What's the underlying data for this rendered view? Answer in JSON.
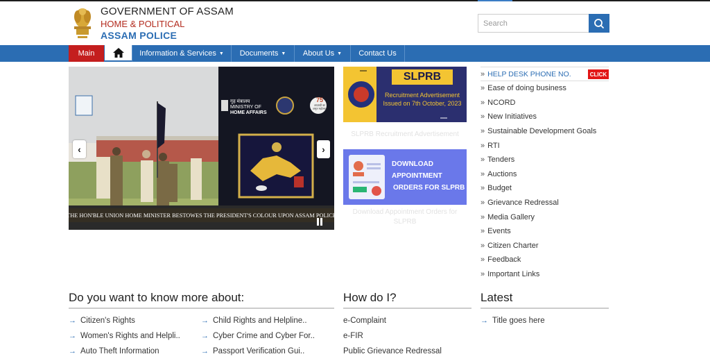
{
  "header": {
    "line1": "GOVERNMENT OF ASSAM",
    "line2": "HOME & POLITICAL",
    "line3": "ASSAM POLICE",
    "search_placeholder": "Search"
  },
  "nav": {
    "main": "Main",
    "info": "Information & Services",
    "documents": "Documents",
    "about": "About Us",
    "contact": "Contact Us"
  },
  "slider": {
    "caption": "THE HON'BLE UNION HOME MINISTER BESTOWES THE PRESIDENT'S COLOUR UPON ASSAM POLICE",
    "ministry_hi": "गृह मंत्रालय",
    "ministry_en1": "MINISTRY OF",
    "ministry_en2": "HOME AFFAIRS",
    "seventy_five": "75",
    "seventy_five_sub": "आज़ादी का अमृत महोत्सव"
  },
  "cards": [
    {
      "banner_title": "SLPRB",
      "banner_text1": "Recruitment Advertisement",
      "banner_text2": "Issued on 7th October, 2023",
      "title": "SLPRB Recruitment Advertisement"
    },
    {
      "banner_text1": "DOWNLOAD",
      "banner_text2": "APPOINTMENT",
      "banner_text3": "ORDERS FOR SLPRB",
      "title": "Download Appointment Orders for SLPRB"
    }
  ],
  "right_links": {
    "help": "HELP DESK PHONE NO.",
    "click": "CLICK",
    "items": [
      "Ease of doing business",
      "NCORD",
      "New Initiatives",
      "Sustainable Development Goals",
      "RTI",
      "Tenders",
      "Auctions",
      "Budget",
      "Grievance Redressal",
      "Media Gallery",
      "Events",
      "Citizen Charter",
      "Feedback",
      "Important Links"
    ]
  },
  "know_more": {
    "title": "Do you want to know more about:",
    "col1": [
      "Citizen's Rights",
      "Women's Rights and Helpli..",
      "Auto Theft Information"
    ],
    "col2": [
      "Child Rights and Helpline..",
      "Cyber Crime and Cyber For..",
      "Passport Verification Gui.."
    ]
  },
  "how_do_i": {
    "title": "How do I?",
    "items": [
      "e-Complaint",
      "e-FIR",
      "Public Grievance Redressal"
    ]
  },
  "latest": {
    "title": "Latest",
    "items": [
      "Title goes here"
    ]
  }
}
